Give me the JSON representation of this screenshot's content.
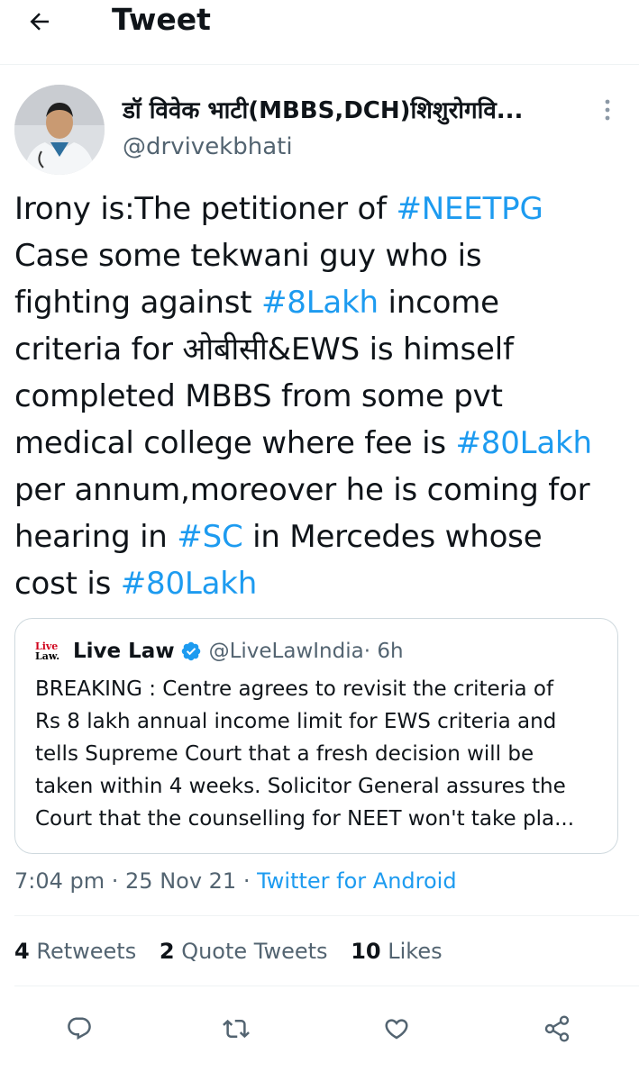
{
  "header": {
    "title": "Tweet"
  },
  "tweet": {
    "author_name": "डॉ विवेक भाटी(MBBS,DCH)शिशुरोगवि...",
    "author_handle": "@drvivekbhati",
    "lines": [
      {
        "text": "Irony is:The petitioner of ",
        "tag": "#NEETPG",
        "after": ""
      },
      {
        "text": "Case some tekwani guy who is",
        "tag": "",
        "after": ""
      },
      {
        "text": "fighting against ",
        "tag": "#8Lakh",
        "after": " income"
      },
      {
        "text": "criteria for ओबीसी&EWS is himself",
        "tag": "",
        "after": ""
      },
      {
        "text": "completed MBBS from some pvt",
        "tag": "",
        "after": ""
      },
      {
        "text": "medical college where fee is ",
        "tag": "#80Lakh",
        "after": ""
      },
      {
        "text": "per annum,moreover he is coming for",
        "tag": "",
        "after": ""
      },
      {
        "text": "hearing in ",
        "tag": "#SC",
        "after": " in Mercedes whose"
      },
      {
        "text": "cost is ",
        "tag": "#80Lakh",
        "after": ""
      }
    ],
    "timestamp": "7:04 pm · 25 Nov 21 · ",
    "source": "Twitter for Android"
  },
  "quote": {
    "logo_line1": "Live",
    "logo_line2": "Law.",
    "name": "Live Law",
    "handle": "@LiveLawIndia",
    "time": " · 6h",
    "lines": [
      "BREAKING : Centre agrees to revisit the criteria of",
      "Rs 8 lakh annual income limit for EWS criteria and",
      "tells Supreme Court that a fresh decision will be",
      "taken within 4 weeks. Solicitor General assures the",
      "Court that the counselling for NEET won't take pla..."
    ]
  },
  "stats": {
    "retweets_count": "4",
    "retweets_label": "Retweets",
    "quotes_count": "2",
    "quotes_label": "Quote Tweets",
    "likes_count": "10",
    "likes_label": "Likes"
  },
  "colors": {
    "accent": "#1d9bf0",
    "secondary": "#536471",
    "text": "#0f1419"
  },
  "icons": [
    "back-arrow-icon",
    "more-vertical-icon",
    "verified-badge-icon",
    "reply-icon",
    "retweet-icon",
    "like-icon",
    "share-icon"
  ]
}
